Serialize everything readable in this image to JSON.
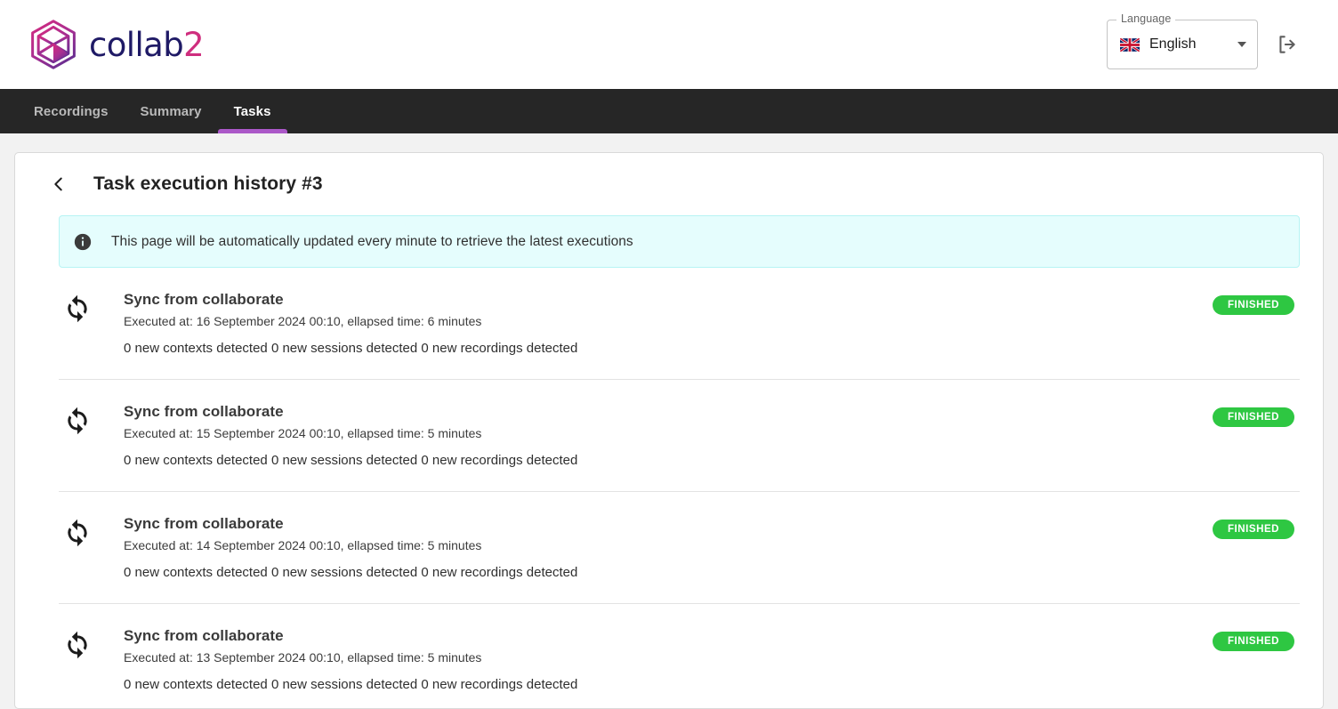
{
  "header": {
    "brand": {
      "name_dark": "collab",
      "name_pink": "2",
      "logo_icon": "hexagon-facet-logo"
    },
    "language": {
      "legend": "Language",
      "selected": "English",
      "flag_icon": "uk-flag-icon",
      "caret_icon": "chevron-down-icon"
    },
    "logout": {
      "icon": "logout-icon",
      "label": "Logout"
    }
  },
  "nav": {
    "tabs": [
      {
        "label": "Recordings",
        "active": false
      },
      {
        "label": "Summary",
        "active": false
      },
      {
        "label": "Tasks",
        "active": true
      }
    ],
    "active_underline_color": "#ab58c8"
  },
  "page": {
    "back_icon": "chevron-left-icon",
    "title": "Task execution history #3",
    "alert": {
      "icon": "info-icon",
      "text": "This page will be automatically updated every minute to retrieve the latest executions",
      "background_color": "#e5fdfd"
    }
  },
  "executions": [
    {
      "icon": "sync-icon",
      "title": "Sync from collaborate",
      "meta": "Executed at: 16 September 2024 00:10, ellapsed time: 6 minutes",
      "detail": "0 new contexts detected 0 new sessions detected 0 new recordings detected",
      "status": "FINISHED",
      "status_color": "#2ec742"
    },
    {
      "icon": "sync-icon",
      "title": "Sync from collaborate",
      "meta": "Executed at: 15 September 2024 00:10, ellapsed time: 5 minutes",
      "detail": "0 new contexts detected 0 new sessions detected 0 new recordings detected",
      "status": "FINISHED",
      "status_color": "#2ec742"
    },
    {
      "icon": "sync-icon",
      "title": "Sync from collaborate",
      "meta": "Executed at: 14 September 2024 00:10, ellapsed time: 5 minutes",
      "detail": "0 new contexts detected 0 new sessions detected 0 new recordings detected",
      "status": "FINISHED",
      "status_color": "#2ec742"
    },
    {
      "icon": "sync-icon",
      "title": "Sync from collaborate",
      "meta": "Executed at: 13 September 2024 00:10, ellapsed time: 5 minutes",
      "detail": "0 new contexts detected 0 new sessions detected 0 new recordings detected",
      "status": "FINISHED",
      "status_color": "#2ec742"
    }
  ]
}
